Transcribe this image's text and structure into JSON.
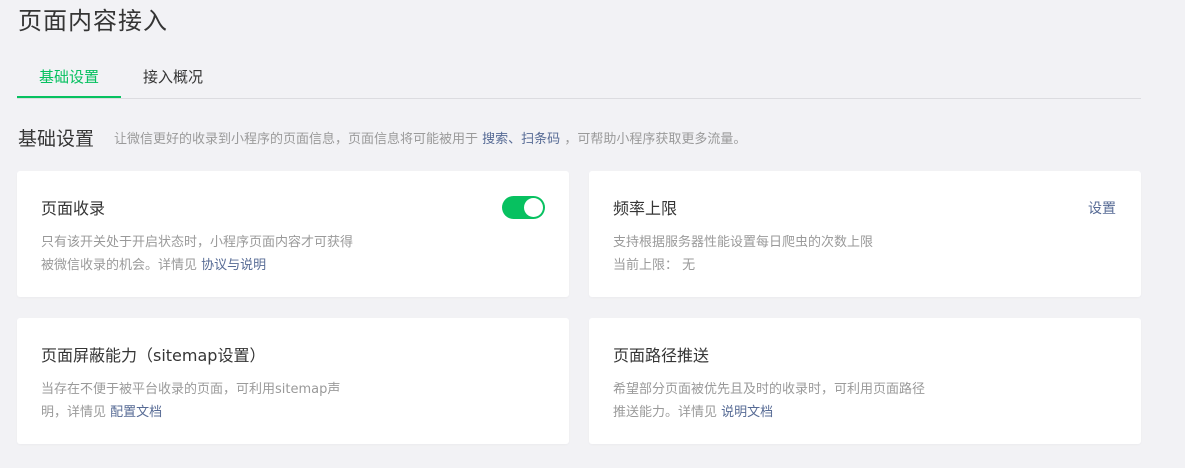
{
  "page": {
    "title": "页面内容接入"
  },
  "tabs": [
    {
      "label": "基础设置",
      "active": true
    },
    {
      "label": "接入概况",
      "active": false
    }
  ],
  "section": {
    "title": "基础设置",
    "desc_prefix": "让微信更好的收录到小程序的页面信息，页面信息将可能被用于",
    "desc_link": "搜索、扫条码",
    "desc_suffix": "，可帮助小程序获取更多流量。"
  },
  "cards": {
    "page_index": {
      "title": "页面收录",
      "desc_line1": "只有该开关处于开启状态时，小程序页面内容才可获得",
      "desc_line2_prefix": "被微信收录的机会。详情见",
      "desc_link": "协议与说明",
      "toggle_on": true
    },
    "rate_limit": {
      "title": "频率上限",
      "action_label": "设置",
      "desc_line1": "支持根据服务器性能设置每日爬虫的次数上限",
      "desc_line2": "当前上限： 无"
    },
    "sitemap": {
      "title": "页面屏蔽能力（sitemap设置）",
      "desc_line1": "当存在不便于被平台收录的页面，可利用sitemap声",
      "desc_line2_prefix": "明，详情见",
      "desc_link": "配置文档"
    },
    "path_push": {
      "title": "页面路径推送",
      "desc_line1": "希望部分页面被优先且及时的收录时，可利用页面路径",
      "desc_line2_prefix": "推送能力。详情见",
      "desc_link": "说明文档"
    }
  },
  "colors": {
    "accent": "#07c160",
    "link": "#576b95",
    "muted": "#9a9a9a",
    "bg": "#f2f2f5"
  }
}
